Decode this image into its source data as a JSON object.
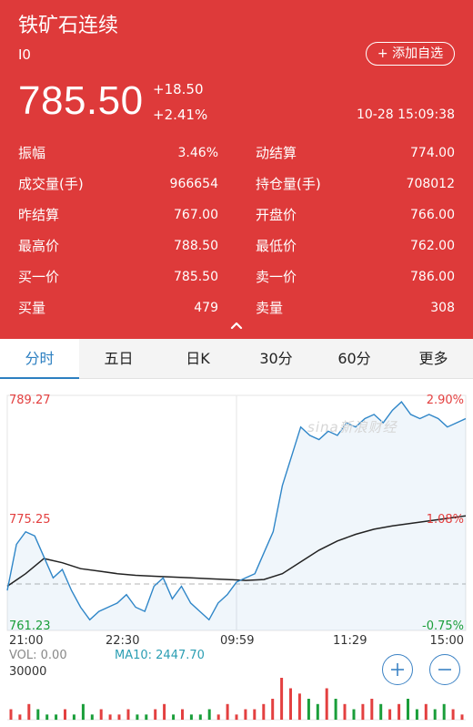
{
  "header": {
    "title": "铁矿石连续",
    "code": "I0",
    "add_button": "+ 添加自选",
    "price": "785.50",
    "change": "+18.50",
    "change_pct": "+2.41%",
    "timestamp": "10-28 15:09:38",
    "bg_color": "#de3a3a"
  },
  "stats": [
    {
      "label": "振幅",
      "value": "3.46%"
    },
    {
      "label": "动结算",
      "value": "774.00"
    },
    {
      "label": "成交量(手)",
      "value": "966654"
    },
    {
      "label": "持仓量(手)",
      "value": "708012"
    },
    {
      "label": "昨结算",
      "value": "767.00"
    },
    {
      "label": "开盘价",
      "value": "766.00"
    },
    {
      "label": "最高价",
      "value": "788.50"
    },
    {
      "label": "最低价",
      "value": "762.00"
    },
    {
      "label": "买一价",
      "value": "785.50"
    },
    {
      "label": "卖一价",
      "value": "786.00"
    },
    {
      "label": "买量",
      "value": "479"
    },
    {
      "label": "卖量",
      "value": "308"
    }
  ],
  "tabs": [
    "分时",
    "五日",
    "日K",
    "30分",
    "60分",
    "更多"
  ],
  "active_tab": "分时",
  "chart": {
    "y_top": "789.27",
    "y_mid": "775.25",
    "y_bottom": "761.23",
    "pct_top": "2.90%",
    "pct_mid": "1.08%",
    "pct_bottom": "-0.75%",
    "x_labels": [
      "21:00",
      "22:30",
      "09:59",
      "11:29",
      "15:00"
    ],
    "vol_label": "VOL: 0.00",
    "ma_label": "MA10: 2447.70",
    "vol_scale": "30000",
    "watermark": "sina新浪财经"
  },
  "chart_data": {
    "type": "line",
    "title": "",
    "x_labels": [
      "21:00",
      "22:30",
      "09:59",
      "11:29",
      "15:00"
    ],
    "ylim": [
      761.23,
      789.27
    ],
    "prev_settle": 767.0,
    "series": [
      {
        "name": "",
        "x": [
          0,
          2,
          4,
          6,
          8,
          10,
          12,
          14,
          16,
          18,
          20,
          22,
          24,
          26,
          28,
          30,
          32,
          34,
          36,
          38,
          40,
          42,
          44,
          46,
          48,
          50,
          52,
          54,
          56,
          58,
          60,
          62,
          64,
          66,
          68,
          70,
          72,
          74,
          76,
          78,
          80,
          82,
          84,
          86,
          88,
          90,
          92,
          94,
          96,
          98,
          100
        ],
        "values": [
          766.0,
          771.5,
          773.0,
          772.5,
          770.0,
          767.5,
          768.5,
          766.0,
          764.0,
          762.5,
          763.5,
          764.0,
          764.5,
          765.5,
          764.0,
          763.5,
          766.5,
          767.5,
          765.0,
          766.5,
          764.5,
          763.5,
          762.5,
          764.5,
          765.5,
          767.0,
          767.5,
          768.0,
          770.5,
          773.0,
          778.5,
          782.0,
          785.5,
          784.5,
          784.0,
          785.0,
          784.5,
          786.0,
          785.5,
          786.5,
          787.0,
          786.0,
          787.5,
          788.5,
          787.0,
          786.5,
          787.0,
          786.5,
          785.5,
          786.0,
          786.5
        ]
      },
      {
        "name": "",
        "x": [
          0,
          4,
          8,
          12,
          16,
          20,
          24,
          28,
          32,
          36,
          40,
          44,
          48,
          52,
          56,
          60,
          64,
          68,
          72,
          76,
          80,
          84,
          88,
          92,
          96,
          100
        ],
        "values": [
          766.5,
          768.0,
          769.8,
          769.3,
          768.6,
          768.3,
          768.0,
          767.8,
          767.7,
          767.6,
          767.5,
          767.4,
          767.3,
          767.2,
          767.3,
          768.0,
          769.4,
          770.8,
          771.9,
          772.7,
          773.3,
          773.7,
          774.0,
          774.3,
          774.6,
          774.9
        ]
      }
    ],
    "volume": [
      2,
      1,
      3,
      2,
      1,
      1,
      2,
      1,
      3,
      1,
      2,
      1,
      1,
      2,
      1,
      1,
      2,
      3,
      1,
      2,
      1,
      1,
      2,
      1,
      3,
      1,
      2,
      2,
      3,
      4,
      8,
      6,
      5,
      4,
      3,
      6,
      4,
      3,
      2,
      3,
      4,
      3,
      2,
      3,
      4,
      2,
      3,
      2,
      3,
      2,
      1
    ]
  }
}
